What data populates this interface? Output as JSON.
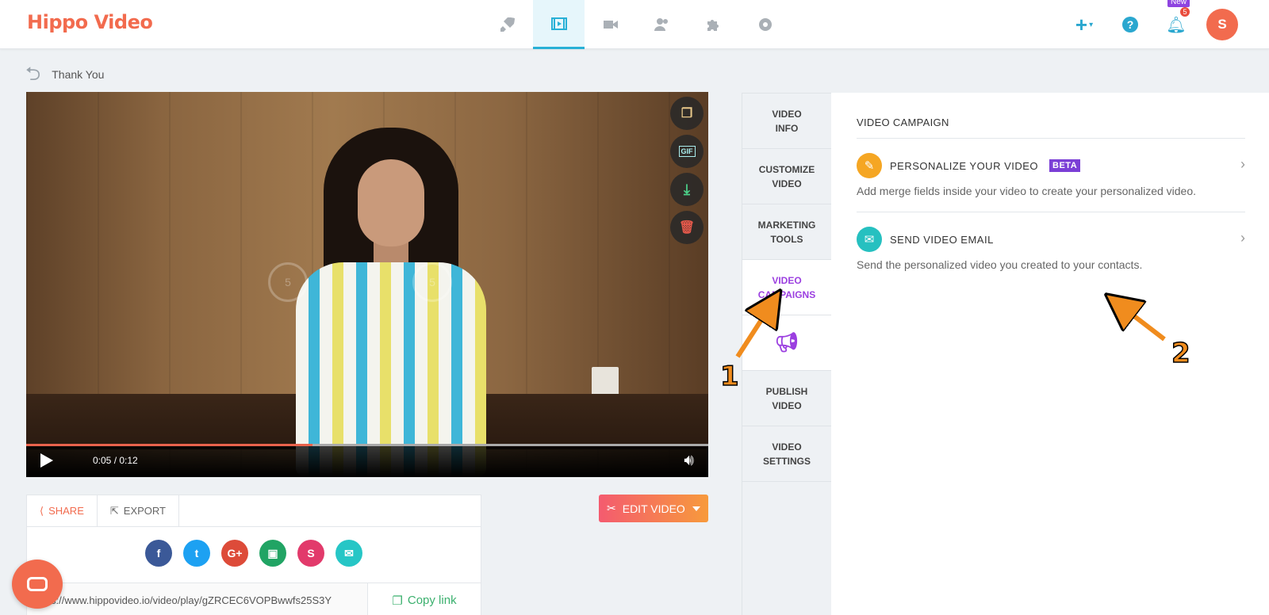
{
  "app": {
    "logo": "Hippo Video"
  },
  "nav": [
    "rocket-icon",
    "video-icon",
    "camera-icon",
    "users-icon",
    "puzzle-icon",
    "gear-icon"
  ],
  "header": {
    "plus": "+",
    "help": "?",
    "new_badge": "New",
    "notif_count": "5",
    "avatar_letter": "S"
  },
  "breadcrumb": {
    "title": "Thank You"
  },
  "video": {
    "time": "0:05 / 0:12",
    "progress": 0.42,
    "skip_back": "5",
    "skip_fwd": "5",
    "gif_label": "GIF"
  },
  "share": {
    "tab_share": "SHARE",
    "tab_export": "EXPORT",
    "url": "s://www.hippovideo.io/video/play/gZRCEC6VOPBwwfs25S3Y",
    "copy_link": "Copy link",
    "social": [
      {
        "name": "facebook",
        "glyph": "f",
        "color": "#3b5998"
      },
      {
        "name": "twitter",
        "glyph": "t",
        "color": "#1da1f2"
      },
      {
        "name": "google-plus",
        "glyph": "G+",
        "color": "#dd4b39"
      },
      {
        "name": "google-classroom",
        "glyph": "▣",
        "color": "#21a464"
      },
      {
        "name": "slack",
        "glyph": "S",
        "color": "#e23a6b"
      },
      {
        "name": "email",
        "glyph": "✉",
        "color": "#26c6c6"
      }
    ]
  },
  "edit_video": {
    "label": "EDIT VIDEO"
  },
  "sidetabs": {
    "video_info": "VIDEO INFO",
    "customize": "CUSTOMIZE VIDEO",
    "marketing": "MARKETING TOOLS",
    "campaigns": "VIDEO CAMPAIGNS",
    "publish": "PUBLISH VIDEO",
    "settings": "VIDEO SETTINGS"
  },
  "campaign": {
    "heading": "VIDEO CAMPAIGN",
    "personalize_title": "PERSONALIZE YOUR VIDEO",
    "personalize_badge": "BETA",
    "personalize_desc": "Add merge fields inside your video to create your personalized video.",
    "email_title": "SEND VIDEO EMAIL",
    "email_desc": "Send the personalized video you created to your contacts."
  },
  "annotations": {
    "one": "1",
    "two": "2"
  },
  "colors": {
    "accent": "#28b0d6",
    "brand": "#f26b4e",
    "active_tab": "#9b3fe0",
    "annotation": "#f08c1e"
  }
}
